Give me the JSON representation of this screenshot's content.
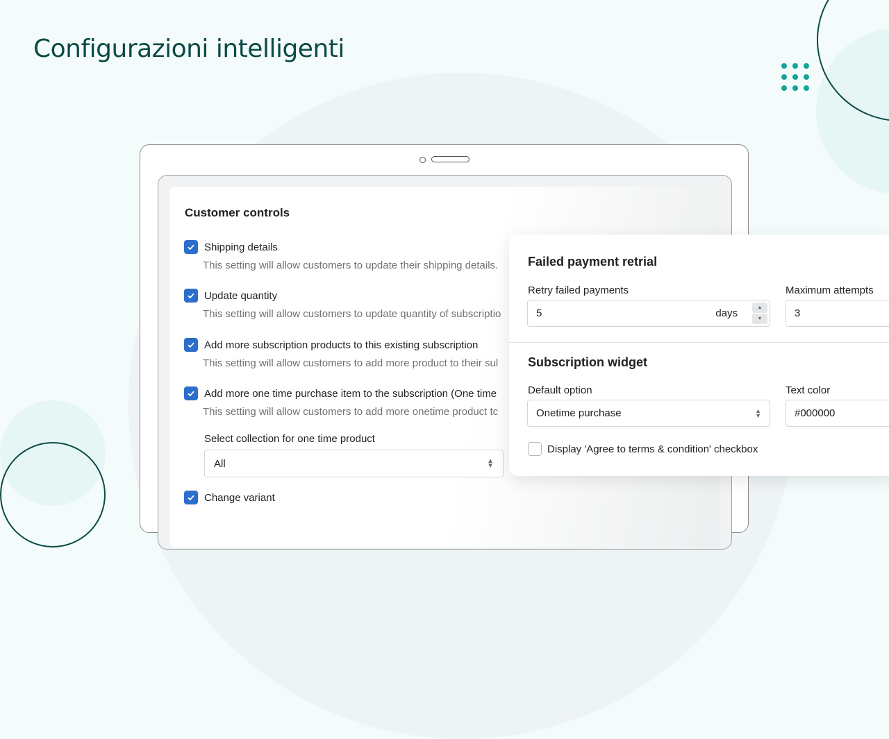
{
  "page": {
    "title": "Configurazioni intelligenti"
  },
  "customer_controls": {
    "title": "Customer controls",
    "options": [
      {
        "label": "Shipping details",
        "help": "This setting will allow customers to update their shipping details.",
        "checked": true
      },
      {
        "label": "Update quantity",
        "help": "This setting will allow customers to update quantity of subscriptio",
        "checked": true
      },
      {
        "label": "Add more subscription products to this existing subscription",
        "help": "This setting will allow customers to add more product to their sul",
        "checked": true
      },
      {
        "label": "Add more one time purchase item to the subscription (One time",
        "help": "This setting will allow customers to add more onetime product tc",
        "checked": true
      },
      {
        "label": "Change variant",
        "help": "",
        "checked": true
      }
    ],
    "collection_select": {
      "label": "Select collection for one time product",
      "value": "All"
    }
  },
  "failed_payment": {
    "title": "Failed payment retrial",
    "retry": {
      "label": "Retry failed payments",
      "value": "5",
      "suffix": "days"
    },
    "max_attempts": {
      "label": "Maximum attempts",
      "value": "3"
    }
  },
  "subscription_widget": {
    "title": "Subscription widget",
    "default_option": {
      "label": "Default option",
      "value": "Onetime purchase"
    },
    "text_color": {
      "label": "Text color",
      "value": "#000000"
    },
    "terms_checkbox": {
      "label": "Display 'Agree to terms & condition' checkbox",
      "checked": false
    }
  },
  "colors": {
    "brand_dark": "#0b4a45",
    "accent_teal": "#12a39a",
    "checkbox_blue": "#2c6ecb"
  }
}
